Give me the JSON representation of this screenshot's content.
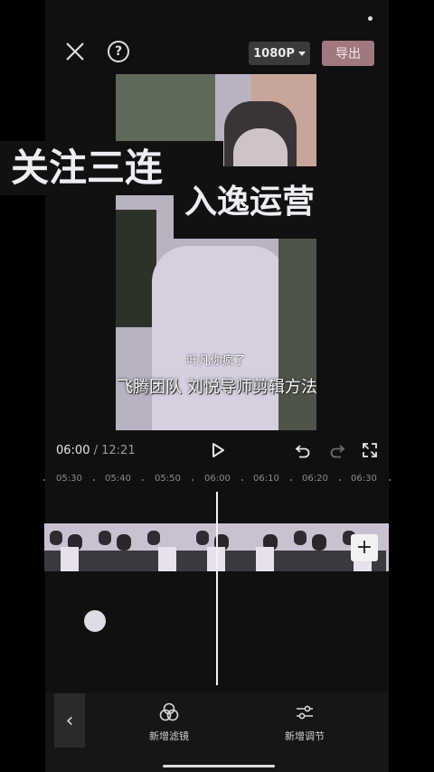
{
  "header": {
    "resolution_label": "1080P",
    "export_label": "导出",
    "help_label": "?"
  },
  "preview": {
    "caption_line1": "关注三连",
    "caption_line2": "入逸运营",
    "subtitle_small": "叶凡你疯了",
    "subtitle_large": "飞腾团队 刘悦导师剪辑方法"
  },
  "playback": {
    "current_time": "06:00",
    "separator": " / ",
    "total_time": "12:21"
  },
  "ruler": {
    "ticks": [
      "05:30",
      "05:40",
      "05:50",
      "06:00",
      "06:10",
      "06:20",
      "06:30"
    ]
  },
  "timeline": {
    "add_clip_label": "+"
  },
  "toolbar": {
    "back_label": "‹",
    "filter_label": "新增滤镜",
    "adjust_label": "新增调节"
  },
  "colors": {
    "accent_export": "#a0787d",
    "background": "#000000"
  },
  "icons": [
    "close-icon",
    "help-icon",
    "caret-down-icon",
    "play-icon",
    "undo-icon",
    "redo-icon",
    "fullscreen-icon",
    "plus-icon",
    "chevron-left-icon",
    "filter-icon",
    "adjust-icon"
  ]
}
